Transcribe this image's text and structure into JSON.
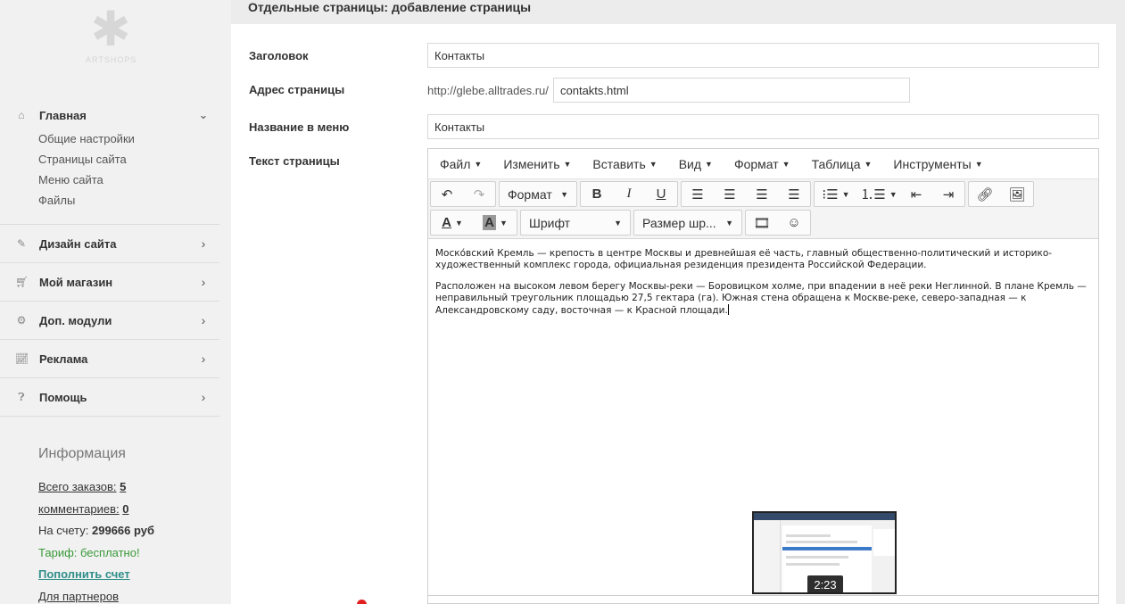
{
  "page_title": "Отдельные страницы: добавление страницы",
  "logo": {
    "icon": "snowflake-logo-icon",
    "text": "ARTSHOPS"
  },
  "sidebar": {
    "main": {
      "label": "Главная",
      "icon": "home-icon",
      "items": [
        "Общие настройки",
        "Страницы сайта",
        "Меню сайта",
        "Файлы"
      ]
    },
    "sections": [
      {
        "label": "Дизайн сайта",
        "icon": "brush-icon"
      },
      {
        "label": "Мой магазин",
        "icon": "cart-icon"
      },
      {
        "label": "Доп. модули",
        "icon": "cogs-icon"
      },
      {
        "label": "Реклама",
        "icon": "chart-icon"
      },
      {
        "label": "Помощь",
        "icon": "question-icon"
      }
    ]
  },
  "info": {
    "heading": "Информация",
    "orders_label": "Всего заказов:",
    "orders_value": "5",
    "comments_label": "комментариев:",
    "comments_value": "0",
    "balance_label": "На счету:",
    "balance_value": "299666 руб",
    "tariff": "Тариф: бесплатно!",
    "topup": "Пополнить счет",
    "partners": "Для партнеров"
  },
  "form": {
    "title_label": "Заголовок",
    "title_value": "Контакты",
    "url_label": "Адрес страницы",
    "url_prefix": "http://glebe.alltrades.ru/",
    "url_value": "contakts.html",
    "menu_label": "Название в меню",
    "menu_value": "Контакты",
    "text_label": "Текст страницы"
  },
  "editor": {
    "menu": [
      "Файл",
      "Изменить",
      "Вставить",
      "Вид",
      "Формат",
      "Таблица",
      "Инструменты"
    ],
    "format_label": "Формат",
    "font_label": "Шрифт",
    "size_label": "Размер шр...",
    "paragraph1": "Моско́вский Кремль — крепость в центре Москвы и древнейшая её часть, главный общественно-политический и историко-художественный комплекс города, официальная резиденция президента Российской Федерации.",
    "paragraph2": "Расположен на высоком левом берегу Москвы-реки — Боровицком холме, при впадении в неё реки Неглинной. В плане Кремль — неправильный треугольник площадью 27,5 гектара (га). Южная стена обращена к Москве-реке, северо-западная — к Александровскому саду, восточная — к Красной площади."
  },
  "video_thumb": {
    "time": "2:23"
  },
  "colors": {
    "accent_green": "#3a9a3a",
    "accent_teal": "#2f8f8a",
    "sidebar_bg": "#f1f1f1"
  }
}
